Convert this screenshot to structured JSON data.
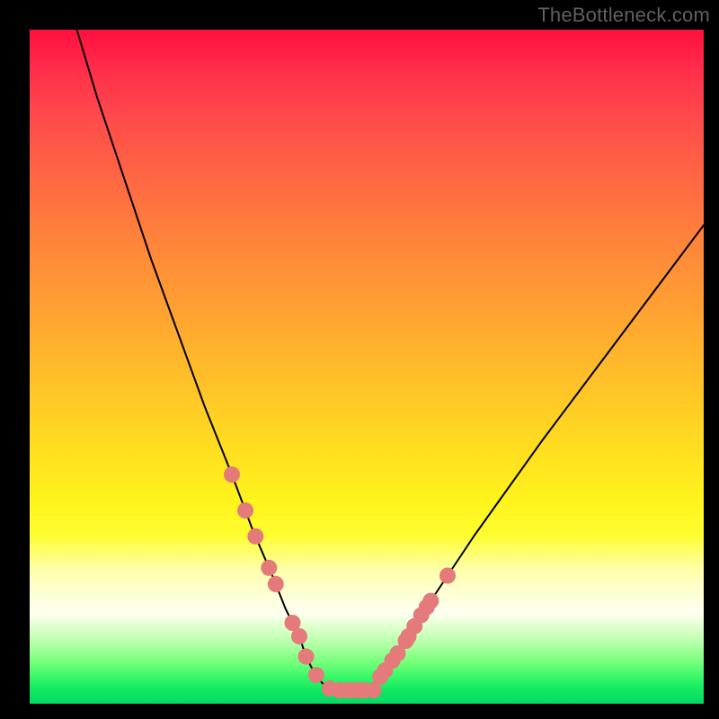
{
  "watermark": "TheBottleneck.com",
  "chart_data": {
    "type": "line",
    "title": "",
    "xlabel": "",
    "ylabel": "",
    "xlim": [
      0,
      100
    ],
    "ylim": [
      0,
      100
    ],
    "series": [
      {
        "name": "left-curve",
        "color": "#000000",
        "x": [
          7,
          10,
          14,
          18,
          22,
          26,
          30,
          33,
          36,
          38,
          40,
          41,
          42,
          43,
          44,
          45
        ],
        "y": [
          100,
          90,
          78,
          66,
          55,
          44,
          34,
          26,
          19,
          14,
          10,
          7,
          5,
          3.5,
          2.5,
          2
        ]
      },
      {
        "name": "floor",
        "color": "#000000",
        "x": [
          45,
          50
        ],
        "y": [
          2,
          2
        ]
      },
      {
        "name": "right-curve",
        "color": "#000000",
        "x": [
          50,
          52,
          55,
          58,
          62,
          66,
          71,
          76,
          82,
          88,
          94,
          100
        ],
        "y": [
          2,
          4,
          8,
          13,
          19,
          25,
          32,
          39,
          47,
          55,
          63,
          71
        ]
      }
    ],
    "markers": {
      "name": "bead-markers",
      "color": "#e47a7a",
      "radius_px": 9,
      "left_branch_fractions": [
        0.3,
        0.32,
        0.335,
        0.355,
        0.365,
        0.39,
        0.4,
        0.41,
        0.425,
        0.445,
        0.46,
        0.475,
        0.49
      ],
      "floor_fractions": [
        0.46,
        0.472,
        0.485,
        0.497,
        0.51
      ],
      "right_branch_fractions": [
        0.52,
        0.527,
        0.538,
        0.546,
        0.558,
        0.562,
        0.571,
        0.581,
        0.589,
        0.595,
        0.62
      ]
    },
    "background_gradient": {
      "stops": [
        {
          "pos": 0.0,
          "color": "#ff0f3e"
        },
        {
          "pos": 0.33,
          "color": "#ff8939"
        },
        {
          "pos": 0.63,
          "color": "#ffe01f"
        },
        {
          "pos": 0.8,
          "color": "#ffffa8"
        },
        {
          "pos": 0.9,
          "color": "#c8ffb8"
        },
        {
          "pos": 1.0,
          "color": "#04d864"
        }
      ]
    }
  }
}
